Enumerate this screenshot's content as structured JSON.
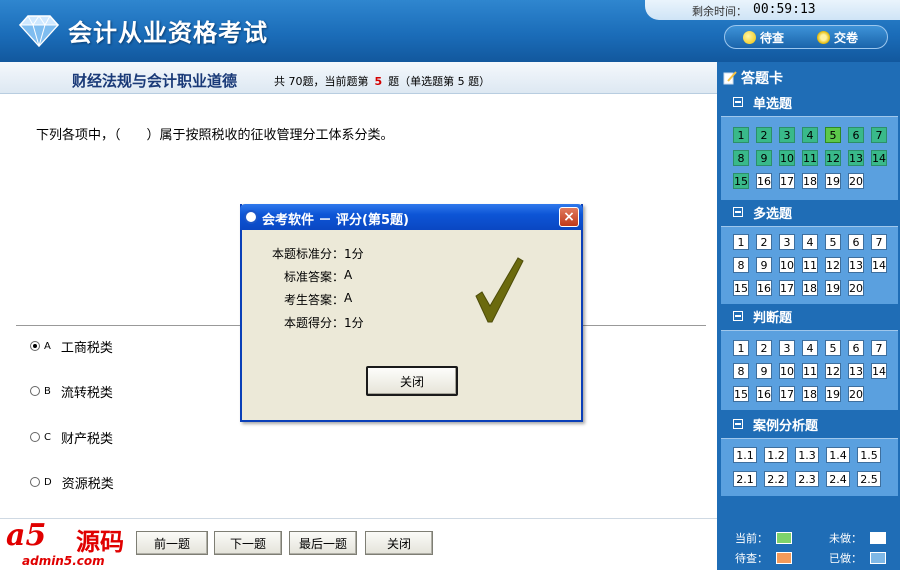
{
  "header": {
    "app_title": "会计从业资格考试",
    "timer_label": "剩余时间：",
    "timer_value": "00:59:13",
    "pending_button": "待查",
    "submit_button": "交卷"
  },
  "subject": {
    "name": "财经法规与会计职业道德",
    "total_prefix": "共 70题，当前题第",
    "current_number": "5",
    "type_suffix": "题（单选题第 5 题）"
  },
  "question": {
    "text": "下列各项中，（　　）属于按照税收的征收管理分工体系分类。",
    "options": [
      {
        "letter": "A",
        "text": "工商税类",
        "selected": true
      },
      {
        "letter": "B",
        "text": "流转税类",
        "selected": false
      },
      {
        "letter": "C",
        "text": "财产税类",
        "selected": false
      },
      {
        "letter": "D",
        "text": "资源税类",
        "selected": false
      }
    ]
  },
  "nav": {
    "prev": "前一题",
    "next": "下一题",
    "last": "最后一题",
    "close": "关闭"
  },
  "watermark": {
    "logo": "a5",
    "brand": "源码",
    "url": "admin5.com"
  },
  "panel": {
    "title": "答题卡",
    "sections": [
      {
        "title": "单选题",
        "items": [
          "1",
          "2",
          "3",
          "4",
          "5",
          "6",
          "7",
          "8",
          "9",
          "10",
          "11",
          "12",
          "13",
          "14",
          "15",
          "16",
          "17",
          "18",
          "19",
          "20"
        ],
        "done": [
          "1",
          "2",
          "3",
          "4",
          "6",
          "7",
          "8",
          "9",
          "10",
          "11",
          "12",
          "13",
          "14",
          "15"
        ],
        "current": "5"
      },
      {
        "title": "多选题",
        "items": [
          "1",
          "2",
          "3",
          "4",
          "5",
          "6",
          "7",
          "8",
          "9",
          "10",
          "11",
          "12",
          "13",
          "14",
          "15",
          "16",
          "17",
          "18",
          "19",
          "20"
        ]
      },
      {
        "title": "判断题",
        "items": [
          "1",
          "2",
          "3",
          "4",
          "5",
          "6",
          "7",
          "8",
          "9",
          "10",
          "11",
          "12",
          "13",
          "14",
          "15",
          "16",
          "17",
          "18",
          "19",
          "20"
        ]
      },
      {
        "title": "案例分析题",
        "items": [
          "1.1",
          "1.2",
          "1.3",
          "1.4",
          "1.5",
          "2.1",
          "2.2",
          "2.3",
          "2.4",
          "2.5"
        ]
      }
    ],
    "legend": {
      "current": "当前：",
      "not_done": "未做：",
      "pending": "待查：",
      "done": "已做："
    },
    "colors": {
      "current": "#7ed36b",
      "not_done": "#ffffff",
      "pending": "#f39a5a",
      "done": "#7fb8e6"
    }
  },
  "dialog": {
    "title": "会考软件 － 评分(第5题)",
    "rows": [
      {
        "label": "本题标准分：",
        "value": "1分"
      },
      {
        "label": "标准答案：",
        "value": "A"
      },
      {
        "label": "考生答案：",
        "value": "A"
      },
      {
        "label": "本题得分：",
        "value": "1分"
      }
    ],
    "close_button": "关闭",
    "close_icon": "×"
  }
}
